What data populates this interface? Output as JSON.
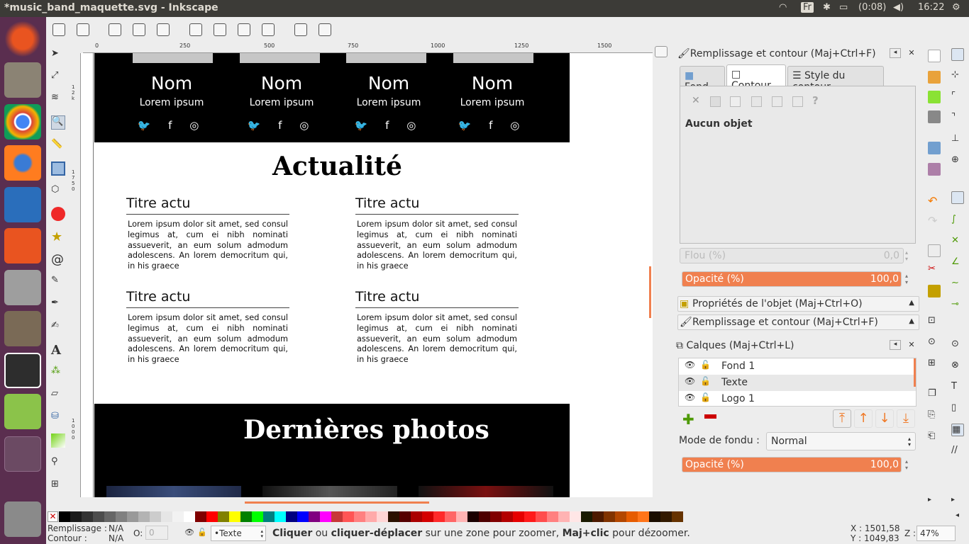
{
  "window": {
    "title": "*music_band_maquette.svg - Inkscape"
  },
  "topbar": {
    "lang": "Fr",
    "battery": "(0:08)",
    "time": "16:22"
  },
  "ruler": {
    "ticks": [
      "0",
      "250",
      "500",
      "750",
      "1000",
      "1250",
      "1500"
    ],
    "vticks": [
      "1",
      "2",
      "k",
      "1",
      "7",
      "5",
      "0",
      "1",
      "0",
      "0",
      "0"
    ]
  },
  "members": [
    {
      "name": "Nom",
      "role": "Lorem ipsum"
    },
    {
      "name": "Nom",
      "role": "Lorem ipsum"
    },
    {
      "name": "Nom",
      "role": "Lorem ipsum"
    },
    {
      "name": "Nom",
      "role": "Lorem ipsum"
    }
  ],
  "social": "🐦 f ◎",
  "actualite": {
    "heading": "Actualité"
  },
  "articles": [
    {
      "title": "Titre actu",
      "text": "Lorem ipsum dolor sit amet, sed consul legimus at, cum ei nibh nominati assueverit, an eum solum admodum adolescens. An lorem democritum qui, in his graece"
    },
    {
      "title": "Titre actu",
      "text": "Lorem ipsum dolor sit amet, sed consul legimus at, cum ei nibh nominati assueverit, an eum solum admodum adolescens. An lorem democritum qui, in his graece"
    },
    {
      "title": "Titre actu",
      "text": "Lorem ipsum dolor sit amet, sed consul legimus at, cum ei nibh nominati assueverit, an eum solum admodum adolescens. An lorem democritum qui, in his graece"
    },
    {
      "title": "Titre actu",
      "text": "Lorem ipsum dolor sit amet, sed consul legimus at, cum ei nibh nominati assueverit, an eum solum admodum adolescens. An lorem democritum qui, in his graece"
    }
  ],
  "photos": {
    "heading": "Dernières photos"
  },
  "fill_panel": {
    "title": "Remplissage et contour (Maj+Ctrl+F)",
    "tabs": [
      "Fond",
      "Contour",
      "Style du contour"
    ],
    "status": "Aucun objet",
    "blur_label": "Flou (%)",
    "blur_value": "0,0",
    "opacity_label": "Opacité (%)",
    "opacity_value": "100,0"
  },
  "collapsed": [
    "Propriétés de l'objet (Maj+Ctrl+O)",
    "Remplissage et contour (Maj+Ctrl+F)"
  ],
  "layers_panel": {
    "title": "Calques (Maj+Ctrl+L)",
    "layers": [
      "Fond 1",
      "Texte",
      "Logo 1"
    ],
    "blend_label": "Mode de fondu :",
    "blend_value": "Normal",
    "opacity_label": "Opacité (%)",
    "opacity_value": "100,0"
  },
  "palette": [
    "#000000",
    "#1a1a1a",
    "#333333",
    "#4d4d4d",
    "#666666",
    "#808080",
    "#999999",
    "#b3b3b3",
    "#cccccc",
    "#e6e6e6",
    "#f2f2f2",
    "#ffffff",
    "#800000",
    "#ff0000",
    "#808000",
    "#ffff00",
    "#008000",
    "#00ff00",
    "#008080",
    "#00ffff",
    "#000080",
    "#0000ff",
    "#800080",
    "#ff00ff",
    "#c83737",
    "#ff5555",
    "#ff8080",
    "#ffaaaa",
    "#ffd5d5",
    "#2b1100",
    "#550000",
    "#aa0000",
    "#d40000",
    "#ff2a2a",
    "#ff6666",
    "#ffb3b3",
    "#1a0000",
    "#4d0000",
    "#800000",
    "#b30000",
    "#e60000",
    "#ff1a1a",
    "#ff4d4d",
    "#ff8080",
    "#ffb3b3",
    "#ffe6e6",
    "#1a1a00",
    "#4d1a00",
    "#803300",
    "#b34700",
    "#e65c00",
    "#ff751a",
    "#1a0d00",
    "#331a00",
    "#663300"
  ],
  "status": {
    "fill_label": "Remplissage :",
    "fill_value": "N/A",
    "stroke_label": "Contour :",
    "stroke_value": "N/A",
    "o_label": "O:",
    "o_value": "0",
    "layer": "•Texte",
    "msg_b1": "Cliquer",
    "msg_1": " ou ",
    "msg_b2": "cliquer-déplacer",
    "msg_2": " sur une zone pour zoomer, ",
    "msg_b3": "Maj+clic",
    "msg_3": " pour dézoomer.",
    "x": "X : 1501,58",
    "y": "Y : 1049,83",
    "z_label": "Z :",
    "zoom": "47%"
  }
}
